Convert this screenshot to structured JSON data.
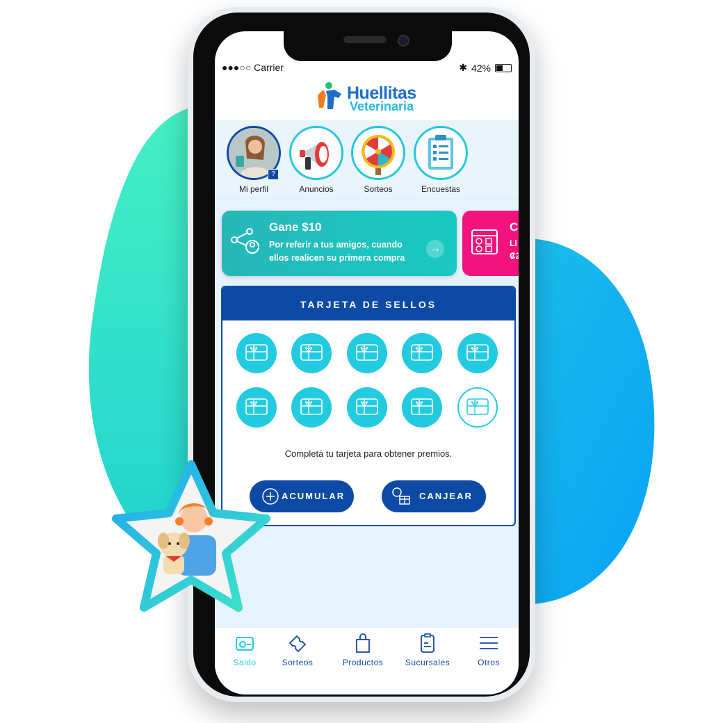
{
  "status_bar": {
    "carrier": "●●●○○ Carrier",
    "battery": "42%"
  },
  "logo": {
    "line1": "Huellitas",
    "line2": "Veterinaria"
  },
  "stories": [
    {
      "label": "Mi perfil",
      "badge": "?",
      "icon": "profile-photo"
    },
    {
      "label": "Anuncios",
      "icon": "megaphone-icon"
    },
    {
      "label": "Sorteos",
      "icon": "wheel-icon"
    },
    {
      "label": "Encuestas",
      "icon": "clipboard-icon"
    }
  ],
  "promo": {
    "title": "Gane $10",
    "text": "Por referir a tus amigos, cuando ellos realicen su primera compra",
    "next_title": "Co",
    "next_text": "Ll",
    "next_extra": "₡2"
  },
  "stamp_card": {
    "title": "TARJETA DE SELLOS",
    "filled": 9,
    "total": 10,
    "message": "Completá tu tarjeta para obtener premios.",
    "accumulate_label": "ACUMULAR",
    "redeem_label": "CANJEAR"
  },
  "tabbar": [
    {
      "label": "Saldo",
      "active": true
    },
    {
      "label": "Sorteos",
      "active": false
    },
    {
      "label": "Productos",
      "active": false
    },
    {
      "label": "Sucursales",
      "active": false
    },
    {
      "label": "Otros",
      "active": false
    }
  ],
  "colors": {
    "accent": "#23cbe0",
    "primary": "#0d4aa6",
    "pink": "#f4137e"
  }
}
